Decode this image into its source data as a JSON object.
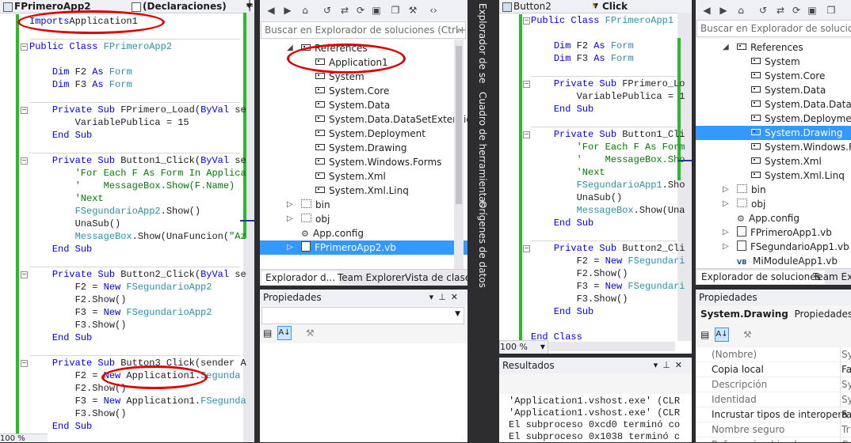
{
  "left_editor": {
    "class_combo": "FPrimeroApp2",
    "member_combo": "(Declaraciones)",
    "zoom": "100 %",
    "lines": [
      [
        [
          "kw",
          "Imports"
        ],
        [
          "",
          "Application1"
        ]
      ],
      [],
      [
        [
          "kw",
          "Public Class"
        ],
        [
          "ty",
          " FPrimeroApp2"
        ]
      ],
      [],
      [
        [
          "",
          "    "
        ],
        [
          "kw",
          "Dim"
        ],
        [
          "",
          " F2 "
        ],
        [
          "kw",
          "As"
        ],
        [
          "ty",
          " Form"
        ]
      ],
      [
        [
          "",
          "    "
        ],
        [
          "kw",
          "Dim"
        ],
        [
          "",
          " F3 "
        ],
        [
          "kw",
          "As"
        ],
        [
          "ty",
          " Form"
        ]
      ],
      [],
      [
        [
          "",
          "    "
        ],
        [
          "kw",
          "Private Sub"
        ],
        [
          "",
          " FPrimero_Load("
        ],
        [
          "kw",
          "ByVal"
        ],
        [
          "",
          " se"
        ]
      ],
      [
        [
          "",
          "        VariablePublica = 15"
        ]
      ],
      [
        [
          "",
          "    "
        ],
        [
          "kw",
          "End Sub"
        ]
      ],
      [],
      [
        [
          "",
          "    "
        ],
        [
          "kw",
          "Private Sub"
        ],
        [
          "",
          " Button1_Click("
        ],
        [
          "kw",
          "ByVal"
        ],
        [
          "",
          " se"
        ]
      ],
      [
        [
          "cm",
          "        'For Each F As Form In Applica"
        ]
      ],
      [
        [
          "cm",
          "        '    MessageBox.Show(F.Name)"
        ]
      ],
      [
        [
          "cm",
          "        'Next"
        ]
      ],
      [
        [
          "ty",
          "        FSegundarioApp2"
        ],
        [
          "",
          ".Show()"
        ]
      ],
      [
        [
          "",
          "        UnaSub()"
        ]
      ],
      [
        [
          "ty",
          "        MessageBox"
        ],
        [
          "",
          ".Show(UnaFuncion("
        ],
        [
          "cm",
          "\"Az"
        ]
      ],
      [
        [
          "",
          "    "
        ],
        [
          "kw",
          "End Sub"
        ]
      ],
      [],
      [
        [
          "",
          "    "
        ],
        [
          "kw",
          "Private Sub"
        ],
        [
          "",
          " Button2_Click("
        ],
        [
          "kw",
          "ByVal"
        ],
        [
          "",
          " se"
        ]
      ],
      [
        [
          "",
          "        F2 = "
        ],
        [
          "kw",
          "New"
        ],
        [
          "ty",
          " FSegundarioApp2"
        ]
      ],
      [
        [
          "",
          "        F2.Show()"
        ]
      ],
      [
        [
          "",
          "        F3 = "
        ],
        [
          "kw",
          "New"
        ],
        [
          "ty",
          " FSegundarioApp2"
        ]
      ],
      [
        [
          "",
          "        F3.Show()"
        ]
      ],
      [
        [
          "",
          "    "
        ],
        [
          "kw",
          "End Sub"
        ]
      ],
      [],
      [
        [
          "",
          "    "
        ],
        [
          "kw",
          "Private Sub"
        ],
        [
          "",
          " Button3_Click(sender A"
        ]
      ],
      [
        [
          "",
          "        F2 = "
        ],
        [
          "kw",
          "New"
        ],
        [
          "",
          " Application1."
        ],
        [
          "ty",
          "Segunda"
        ]
      ],
      [
        [
          "",
          "        F2.Show()"
        ]
      ],
      [
        [
          "",
          "        F3 = "
        ],
        [
          "kw",
          "New"
        ],
        [
          "",
          " Application1."
        ],
        [
          "ty",
          "FSegunda"
        ]
      ],
      [
        [
          "",
          "        F3.Show()"
        ]
      ],
      [
        [
          "",
          "    "
        ],
        [
          "kw",
          "End Sub"
        ]
      ]
    ]
  },
  "left_explorer": {
    "search_placeholder": "Buscar en Explorador de soluciones (Ctrl+",
    "items": [
      {
        "label": "References",
        "kind": "ref",
        "level": 2,
        "expander": "open"
      },
      {
        "label": "Application1",
        "kind": "ref",
        "level": 3
      },
      {
        "label": "System",
        "kind": "ref",
        "level": 3
      },
      {
        "label": "System.Core",
        "kind": "ref",
        "level": 3
      },
      {
        "label": "System.Data",
        "kind": "ref",
        "level": 3
      },
      {
        "label": "System.Data.DataSetExtension",
        "kind": "ref",
        "level": 3
      },
      {
        "label": "System.Deployment",
        "kind": "ref",
        "level": 3
      },
      {
        "label": "System.Drawing",
        "kind": "ref",
        "level": 3
      },
      {
        "label": "System.Windows.Forms",
        "kind": "ref",
        "level": 3
      },
      {
        "label": "System.Xml",
        "kind": "ref",
        "level": 3
      },
      {
        "label": "System.Xml.Linq",
        "kind": "ref",
        "level": 3
      },
      {
        "label": "bin",
        "kind": "folder",
        "level": 2,
        "expander": "closed"
      },
      {
        "label": "obj",
        "kind": "folder",
        "level": 2,
        "expander": "closed"
      },
      {
        "label": "App.config",
        "kind": "config",
        "level": 2
      },
      {
        "label": "FPrimeroApp2.vb",
        "kind": "vb",
        "level": 2,
        "expander": "closed",
        "selected": true
      }
    ],
    "tabs": [
      "Explorador d...",
      "Team Explorer",
      "Vista de clases"
    ],
    "properties_title": "Propiedades"
  },
  "side_strip": {
    "labels": [
      "Explorador de servidores",
      "Cuadro de herramientas",
      "Orígenes de datos"
    ]
  },
  "right_editor": {
    "class_combo": "Button2",
    "member_combo": "Click",
    "zoom": "100 %",
    "lines": [
      [
        [
          "kw",
          "Public Class"
        ],
        [
          "ty",
          " FPrimeroApp1"
        ]
      ],
      [],
      [
        [
          "",
          "    "
        ],
        [
          "kw",
          "Dim"
        ],
        [
          "",
          " F2 "
        ],
        [
          "kw",
          "As"
        ],
        [
          "ty",
          " Form"
        ]
      ],
      [
        [
          "",
          "    "
        ],
        [
          "kw",
          "Dim"
        ],
        [
          "",
          " F3 "
        ],
        [
          "kw",
          "As"
        ],
        [
          "ty",
          " Form"
        ]
      ],
      [],
      [
        [
          "",
          "    "
        ],
        [
          "kw",
          "Private Sub"
        ],
        [
          "",
          " FPrimero_Lo"
        ]
      ],
      [
        [
          "",
          "        VariablePublica = 1"
        ]
      ],
      [
        [
          "",
          "    "
        ],
        [
          "kw",
          "End Sub"
        ]
      ],
      [],
      [
        [
          "",
          "    "
        ],
        [
          "kw",
          "Private Sub"
        ],
        [
          "",
          " Button1_Cli"
        ]
      ],
      [
        [
          "cm",
          "        'For Each F As Form"
        ]
      ],
      [
        [
          "cm",
          "        '    MessageBox.Sho"
        ]
      ],
      [
        [
          "cm",
          "        'Next"
        ]
      ],
      [
        [
          "ty",
          "        FSegundarioApp1"
        ],
        [
          "",
          ".Sho"
        ]
      ],
      [
        [
          "",
          "        UnaSub()"
        ]
      ],
      [
        [
          "ty",
          "        MessageBox"
        ],
        [
          "",
          ".Show(Una"
        ]
      ],
      [
        [
          "",
          "    "
        ],
        [
          "kw",
          "End Sub"
        ]
      ],
      [],
      [
        [
          "",
          "    "
        ],
        [
          "kw",
          "Private Sub"
        ],
        [
          "",
          " Button2_Cli"
        ]
      ],
      [
        [
          "",
          "        F2 = "
        ],
        [
          "kw",
          "New"
        ],
        [
          "ty",
          " FSegundari"
        ]
      ],
      [
        [
          "",
          "        F2.Show()"
        ]
      ],
      [
        [
          "",
          "        F3 = "
        ],
        [
          "kw",
          "New"
        ],
        [
          "ty",
          " FSegundari"
        ]
      ],
      [
        [
          "",
          "        F3.Show()"
        ]
      ],
      [
        [
          "",
          "    "
        ],
        [
          "kw",
          "End Sub"
        ]
      ],
      [],
      [
        [
          "kw",
          "End Class"
        ]
      ]
    ],
    "output": {
      "title": "Resultados",
      "lines": [
        "'Application1.vshost.exe' (CLR",
        "'Application1.vshost.exe' (CLR",
        "El subproceso 0xcd0 terminó co",
        "El subproceso 0x1038 terminó c"
      ]
    }
  },
  "right_explorer": {
    "search_placeholder": "Buscar en Explorador de soluciones",
    "items": [
      {
        "label": "References",
        "kind": "ref",
        "level": 2,
        "expander": "open"
      },
      {
        "label": "System",
        "kind": "ref",
        "level": 3
      },
      {
        "label": "System.Core",
        "kind": "ref",
        "level": 3
      },
      {
        "label": "System.Data",
        "kind": "ref",
        "level": 3
      },
      {
        "label": "System.Data.DataSet",
        "kind": "ref",
        "level": 3
      },
      {
        "label": "System.Deployment",
        "kind": "ref",
        "level": 3
      },
      {
        "label": "System.Drawing",
        "kind": "ref",
        "level": 3,
        "selected": true
      },
      {
        "label": "System.Windows.Fo",
        "kind": "ref",
        "level": 3
      },
      {
        "label": "System.Xml",
        "kind": "ref",
        "level": 3
      },
      {
        "label": "System.Xml.Linq",
        "kind": "ref",
        "level": 3
      },
      {
        "label": "bin",
        "kind": "folder",
        "level": 2,
        "expander": "closed"
      },
      {
        "label": "obj",
        "kind": "folder",
        "level": 2,
        "expander": "closed"
      },
      {
        "label": "App.config",
        "kind": "config",
        "level": 2
      },
      {
        "label": "FPrimeroApp1.vb",
        "kind": "vb",
        "level": 2,
        "expander": "closed"
      },
      {
        "label": "FSegundarioApp1.vb",
        "kind": "vb",
        "level": 2,
        "expander": "closed"
      },
      {
        "label": "MiModuleApp1.vb",
        "kind": "vbmod",
        "level": 2
      }
    ],
    "tabs": [
      "Explorador de soluciones",
      "Team Exp"
    ],
    "properties": {
      "title": "Propiedades",
      "object_name": "System.Drawing",
      "object_desc": "Propiedades de la",
      "rows": [
        {
          "name": "(Nombre)",
          "value": "Sy",
          "grey": true
        },
        {
          "name": "Copia local",
          "value": "Fa",
          "grey": false
        },
        {
          "name": "Descripción",
          "value": "Sy",
          "grey": true
        },
        {
          "name": "Identidad",
          "value": "Sy",
          "grey": true
        },
        {
          "name": "Incrustar tipos de interoperabil",
          "value": "Fa",
          "grey": false
        },
        {
          "name": "Nombre seguro",
          "value": "Tr",
          "grey": true
        },
        {
          "name": "Referencia ubicada",
          "value": "C:",
          "grey": true
        }
      ]
    }
  },
  "colors": {
    "keyword": "#0000ff",
    "type": "#2b91af",
    "comment": "#008000",
    "change_bar": "#2eb82e",
    "annotation": "#e00000",
    "selection": "#3399ff"
  }
}
